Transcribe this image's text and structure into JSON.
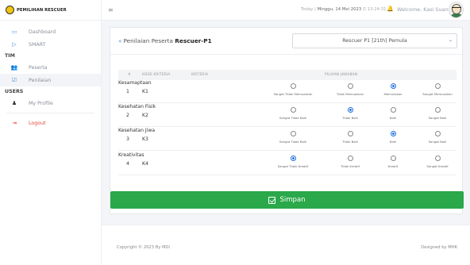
{
  "brand": {
    "name": "PEMILIHAN RESCUER"
  },
  "sidebar": {
    "items": [
      {
        "label": "Dashboard",
        "icon": "monitor-icon"
      },
      {
        "label": "SMART",
        "icon": "play-icon"
      }
    ],
    "tim_heading": "TIM",
    "tim_items": [
      {
        "label": "Peserta",
        "icon": "users-icon"
      },
      {
        "label": "Penilaian",
        "icon": "checklist-icon"
      }
    ],
    "users_heading": "USERS",
    "users_items": [
      {
        "label": "My Profile",
        "icon": "user-icon"
      }
    ],
    "logout_label": "Logout"
  },
  "topbar": {
    "today_label": "Today",
    "today_value": "Minggu, 14 Mei 2023",
    "time": "13:24:31",
    "welcome": "Welcome, Kasi Suanda"
  },
  "page": {
    "back_text": "Penilaian Peserta",
    "participant": "Rescuer-P1",
    "select_value": "Rescuer P1 [21th] Pemula"
  },
  "table": {
    "headers": {
      "no": "#",
      "kode": "KODE KRITERIA",
      "kriteria": "KRITERIA",
      "pilihan": "PILIHAN JAWABAN"
    },
    "rows": [
      {
        "no": "1",
        "kode": "K1",
        "kriteria": "Kesamaptaan",
        "options": [
          "Sangat Tidak Memuaskan",
          "Tidak Memuaskan",
          "Memuaskan",
          "Sangat Memuaskan"
        ],
        "selected": 2
      },
      {
        "no": "2",
        "kode": "K2",
        "kriteria": "Kesehatan Fisik",
        "options": [
          "Sangat Tidak Baik",
          "Tidak Baik",
          "Baik",
          "Sangat Baik"
        ],
        "selected": 1
      },
      {
        "no": "3",
        "kode": "K3",
        "kriteria": "Kesehatan Jiwa",
        "options": [
          "Sangat Tidak Baik",
          "Tidak Baik",
          "Baik",
          "Sangat Baik"
        ],
        "selected": 2
      },
      {
        "no": "4",
        "kode": "K4",
        "kriteria": "Kreativitas",
        "options": [
          "Sangat Tidak Kreatif",
          "Tidak Kreatif",
          "Kreatif",
          "Sangat Kreatif"
        ],
        "selected": 0
      }
    ]
  },
  "actions": {
    "save_label": "Simpan"
  },
  "footer": {
    "copyright": "Copyright © 2023 By MDI",
    "designed": "Designed by MHK"
  },
  "colors": {
    "save_button": "#2aa84a",
    "radio_selected": "#1e6fe0",
    "logout": "#e0483e",
    "accent": "#4a90d9"
  }
}
